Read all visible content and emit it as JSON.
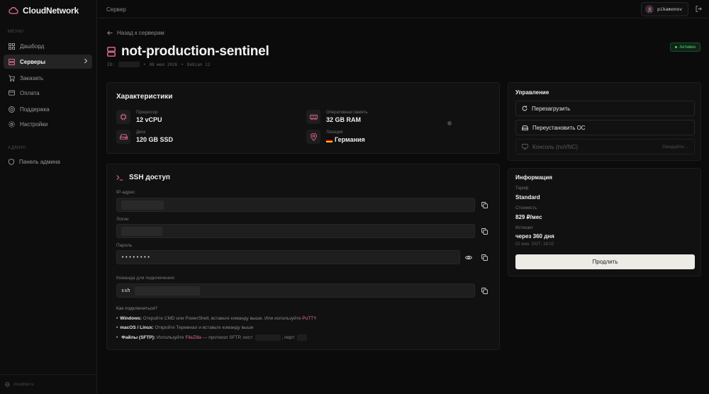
{
  "app": {
    "name": "CloudNetwork",
    "domain": "cloudnw.ru"
  },
  "sidebar": {
    "section_main": "Меню",
    "items": [
      {
        "label": "Дашборд",
        "icon": "grid-icon",
        "active": false
      },
      {
        "label": "Серверы",
        "icon": "server-icon",
        "active": true
      },
      {
        "label": "Заказать",
        "icon": "cart-icon",
        "active": false
      },
      {
        "label": "Оплата",
        "icon": "card-icon",
        "active": false
      },
      {
        "label": "Поддержка",
        "icon": "lifebuoy-icon",
        "active": false
      },
      {
        "label": "Настройки",
        "icon": "gear-icon",
        "active": false
      }
    ],
    "section_admin": "Админ",
    "admin_item": {
      "label": "Панель админа",
      "icon": "shield-icon"
    }
  },
  "topbar": {
    "breadcrumb": "Сервер",
    "username": "pikamonov",
    "avatar_letter": "P"
  },
  "header": {
    "back_label": "Назад к серверам",
    "title": "not-production-sentinel",
    "id_label": "ID:",
    "date": "08 мая 2026",
    "os": "Debian 12",
    "separator": "•",
    "status": "Активен"
  },
  "specs": {
    "title": "Характеристики",
    "items": [
      {
        "label": "Процессор",
        "value": "12 vCPU",
        "icon": "cpu-icon"
      },
      {
        "label": "Оперативная память",
        "value": "32 GB RAM",
        "icon": "memory-icon"
      },
      {
        "label": "Диск",
        "value": "120 GB SSD",
        "icon": "disk-icon"
      },
      {
        "label": "Локация",
        "value": "Германия",
        "icon": "location-icon"
      }
    ]
  },
  "ssh": {
    "title": "SSH доступ",
    "ip_label": "IP-адрес",
    "login_label": "Логин",
    "password_label": "Пароль",
    "password_mask": "••••••••",
    "command_label": "Команда для подключения:",
    "command_prefix": "ssh",
    "howto_title": "Как подключиться?",
    "howto_windows_label": "Windows:",
    "howto_windows_text": "Откройте CMD или PowerShell, вставьте команду выше. Или используйте",
    "howto_windows_link": "PuTTY",
    "howto_mac_label": "macOS / Linux:",
    "howto_mac_text": "Откройте Терминал и вставьте команду выше",
    "howto_files_label": "Файлы (SFTP):",
    "howto_files_text1": "Используйте",
    "howto_files_link": "FileZilla",
    "howto_files_text2": "— протокол SFTP, хост:",
    "howto_files_text3": ", порт:"
  },
  "manage": {
    "title": "Управление",
    "restart_label": "Перезагрузить",
    "reinstall_label": "Переустановить ОС",
    "console_label": "Консоль (noVNC)",
    "console_note": "Ожидайте..."
  },
  "info": {
    "title": "Информация",
    "tariff_label": "Тариф",
    "tariff_value": "Standard",
    "cost_label": "Стоимость",
    "cost_value": "829 ₽/мес",
    "expires_label": "Истекает",
    "expires_value": "через 360 дня",
    "expires_date": "02 мая. 2027, 18:02",
    "extend_label": "Продлить"
  },
  "colors": {
    "accent_pink": "#e86a9c",
    "status_green": "#4fd46e",
    "background": "#0b0b0b"
  }
}
